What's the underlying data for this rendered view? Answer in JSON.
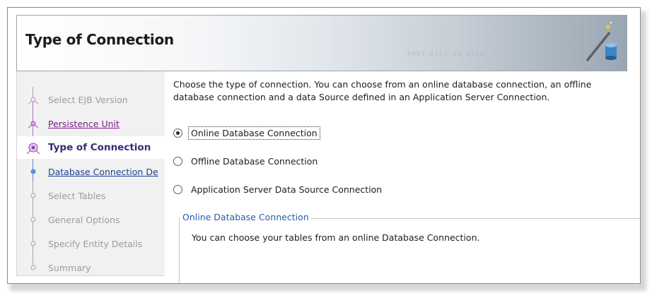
{
  "header": {
    "title": "Type of Connection",
    "watermark": "0001  0101  10  0100"
  },
  "steps": [
    {
      "label": "Select EJB Version",
      "state": "future"
    },
    {
      "label": "Persistence Unit",
      "state": "done"
    },
    {
      "label": "Type of Connection",
      "state": "current"
    },
    {
      "label": "Database Connection De",
      "state": "link"
    },
    {
      "label": "Select Tables",
      "state": "future"
    },
    {
      "label": "General Options",
      "state": "future"
    },
    {
      "label": "Specify Entity Details",
      "state": "future"
    },
    {
      "label": "Summary",
      "state": "future"
    }
  ],
  "content": {
    "description": "Choose the type of connection. You can choose from an online database connection, an offline database connection and a data Source defined in an Application Server Connection.",
    "options": [
      {
        "label": "Online Database Connection",
        "selected": true
      },
      {
        "label": "Offline Database Connection",
        "selected": false
      },
      {
        "label": "Application Server Data Source Connection",
        "selected": false
      }
    ],
    "group": {
      "title": "Online Database Connection",
      "text": "You can choose your tables from an online Database Connection."
    }
  },
  "colors": {
    "done": "#7a1a8c",
    "current": "#3b2a74",
    "link": "#1a3f9a",
    "future": "#9c9c9c",
    "group_title": "#2a5aa8"
  }
}
